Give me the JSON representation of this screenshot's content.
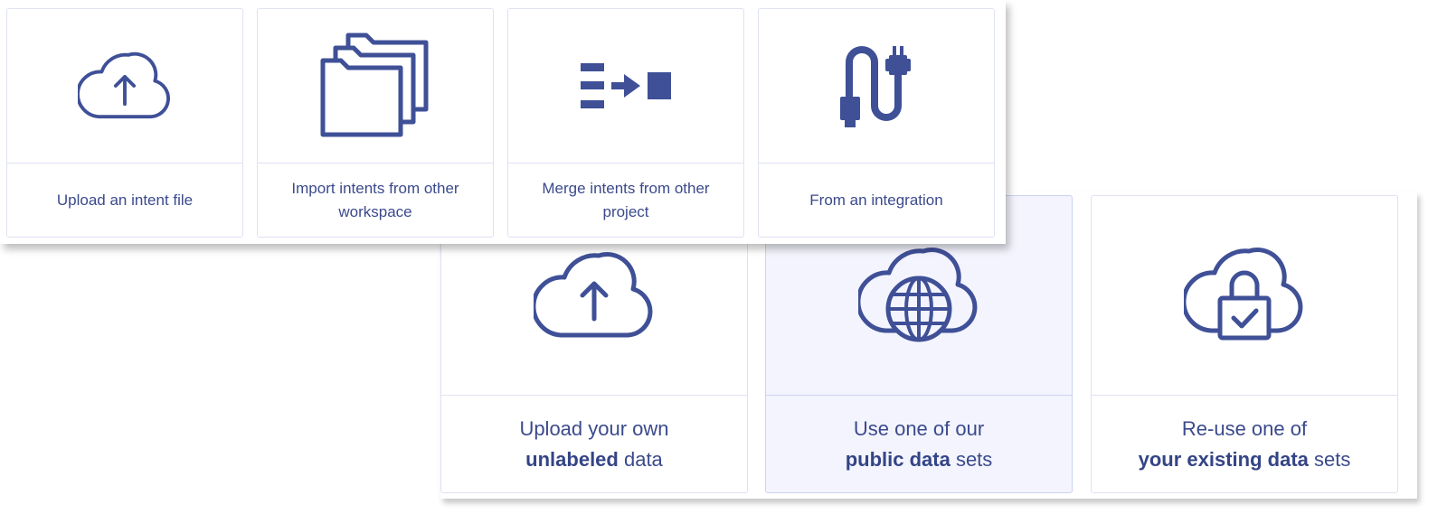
{
  "top_cards": [
    {
      "label": "Upload an intent file",
      "icon": "cloud-upload-icon"
    },
    {
      "label": "Import intents from other workspace",
      "icon": "folders-icon"
    },
    {
      "label": "Merge intents from other project",
      "icon": "merge-arrow-icon"
    },
    {
      "label": "From an integration",
      "icon": "cable-plug-icon"
    }
  ],
  "bottom_cards": [
    {
      "line1": "Upload your own",
      "bold": "unlabeled",
      "rest": " data",
      "icon": "cloud-upload-icon",
      "selected": false
    },
    {
      "line1": "Use one of our",
      "bold": "public data",
      "rest": " sets",
      "icon": "cloud-globe-icon",
      "selected": true
    },
    {
      "line1": "Re-use one of",
      "bold": "your existing data",
      "rest": " sets",
      "icon": "cloud-lock-icon",
      "selected": false
    }
  ],
  "colors": {
    "icon": "#3f5097",
    "text": "#3b4a8c",
    "border": "#dfe2f2",
    "selected_bg": "#f3f4fd"
  }
}
